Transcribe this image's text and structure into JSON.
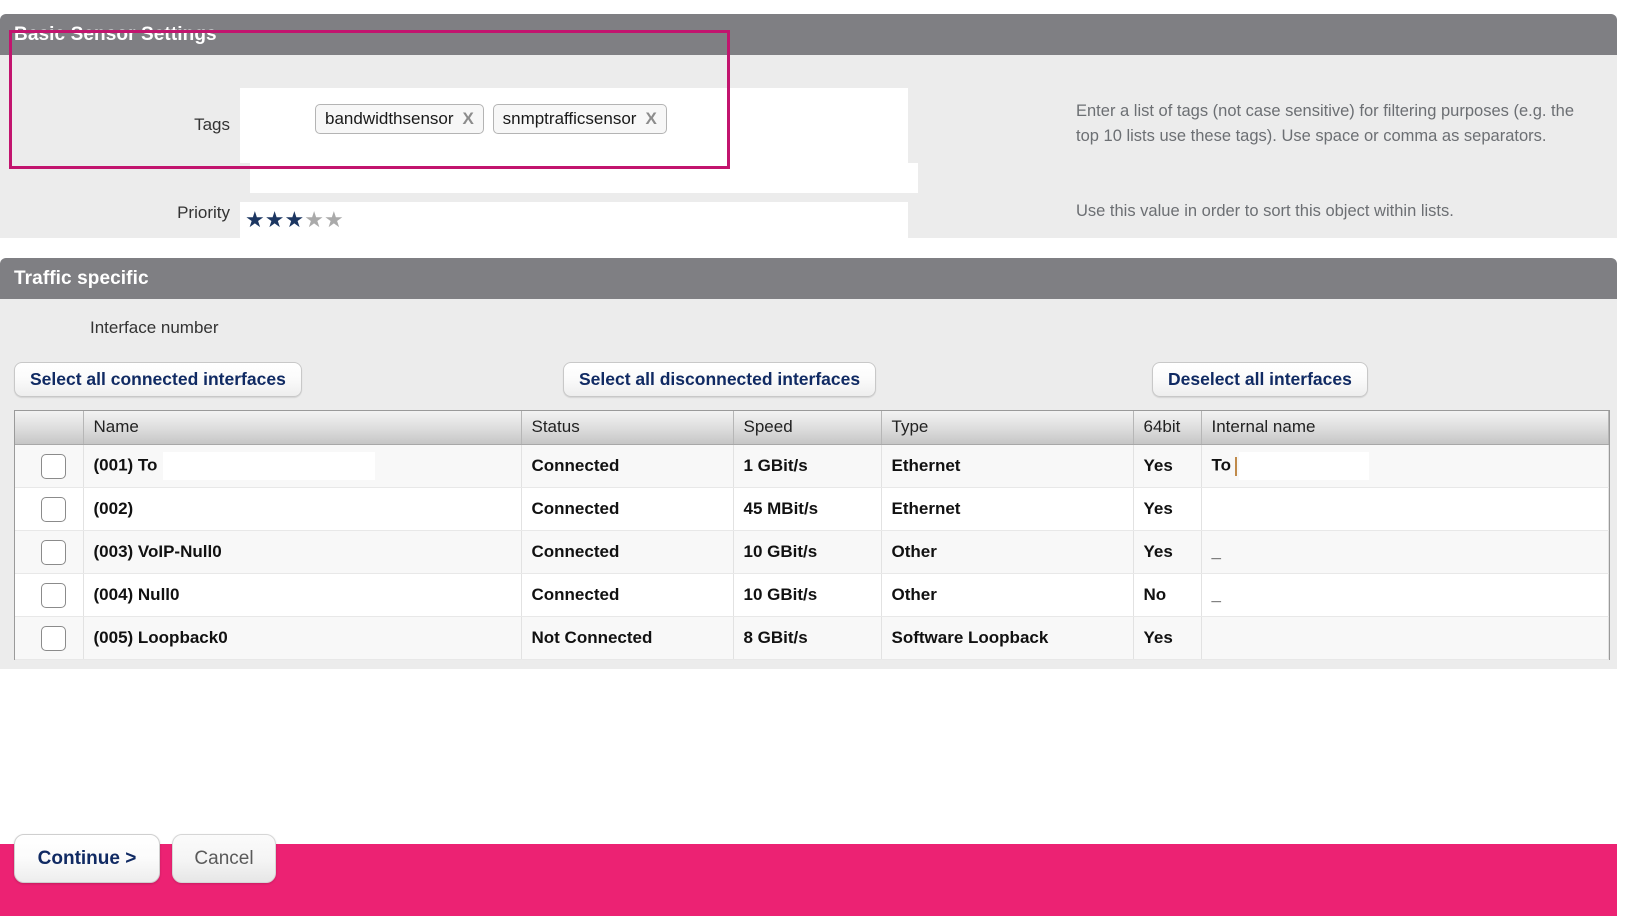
{
  "basic_settings": {
    "title": "Basic Sensor Settings",
    "tags_label": "Tags",
    "tags": [
      {
        "text": "bandwidthsensor",
        "remove": "X"
      },
      {
        "text": "snmptrafficsensor",
        "remove": "X"
      }
    ],
    "priority_label": "Priority",
    "priority_value": 3,
    "priority_max": 5,
    "help_tags": "Enter a list of tags (not case sensitive) for filtering purposes (e.g. the top 10 lists use these tags). Use space or comma as separators.",
    "help_priority": "Use this value in order to sort this object within lists."
  },
  "traffic": {
    "title": "Traffic specific",
    "interface_number_label": "Interface number",
    "buttons": {
      "select_connected": "Select all connected interfaces",
      "select_disconnected": "Select all disconnected interfaces",
      "deselect_all": "Deselect all interfaces"
    },
    "table": {
      "headers": [
        "",
        "Name",
        "Status",
        "Speed",
        "Type",
        "64bit",
        "Internal name"
      ],
      "rows": [
        {
          "checked": false,
          "name": "(001) To",
          "name_redacted": true,
          "status": "Connected",
          "speed": "1 GBit/s",
          "type": "Ethernet",
          "bit64": "Yes",
          "internal": "To",
          "internal_redacted": true
        },
        {
          "checked": false,
          "name": "(002)",
          "name_redacted": false,
          "status": "Connected",
          "speed": "45 MBit/s",
          "type": "Ethernet",
          "bit64": "Yes",
          "internal": "",
          "internal_redacted": false
        },
        {
          "checked": false,
          "name": "(003) VoIP-Null0",
          "name_redacted": false,
          "status": "Connected",
          "speed": "10 GBit/s",
          "type": "Other",
          "bit64": "Yes",
          "internal": "_",
          "internal_redacted": false
        },
        {
          "checked": false,
          "name": "(004) Null0",
          "name_redacted": false,
          "status": "Connected",
          "speed": "10 GBit/s",
          "type": "Other",
          "bit64": "No",
          "internal": "_",
          "internal_redacted": false
        },
        {
          "checked": false,
          "name": "(005) Loopback0",
          "name_redacted": false,
          "status": "Not Connected",
          "speed": "8 GBit/s",
          "type": "Software Loopback",
          "bit64": "Yes",
          "internal": "",
          "internal_redacted": false
        }
      ]
    }
  },
  "actions": {
    "continue": "Continue >",
    "cancel": "Cancel"
  },
  "colors": {
    "accent_pink": "#ec2273",
    "highlight_border": "#c2146e",
    "panel_header": "#7f7f83",
    "link_blue": "#102a63"
  }
}
